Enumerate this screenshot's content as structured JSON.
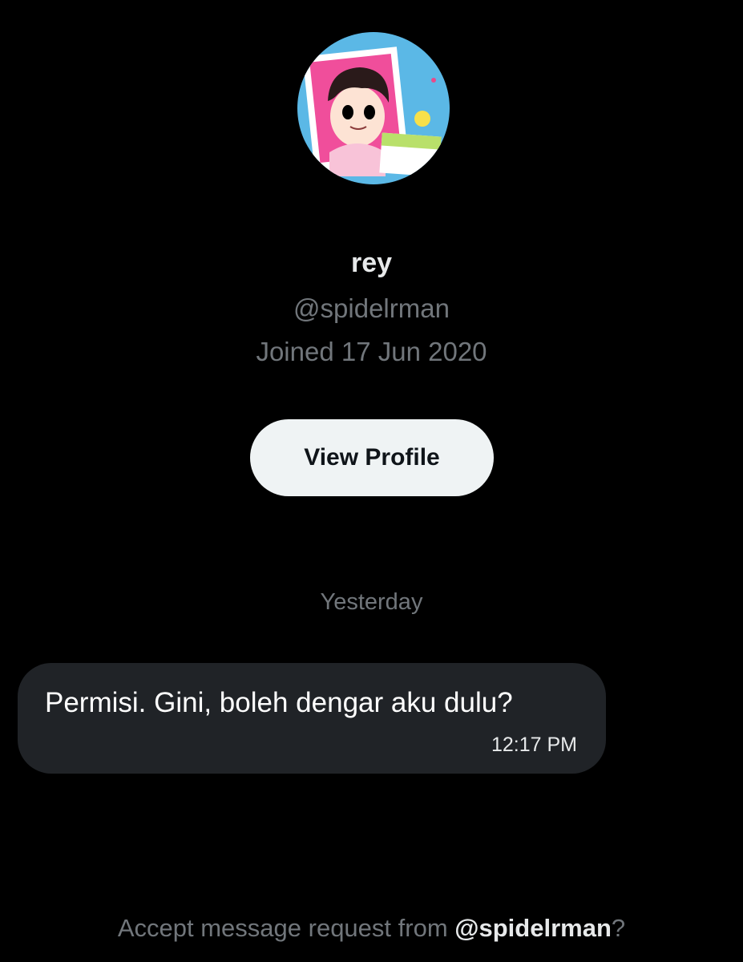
{
  "profile": {
    "avatar_icon": "profile-avatar-illustration",
    "display_name": "rey",
    "handle": "@spidelrman",
    "joined": "Joined 17 Jun 2020",
    "view_profile_label": "View Profile"
  },
  "conversation": {
    "day_separator": "Yesterday",
    "messages": [
      {
        "text": "Permisi. Gini, boleh dengar aku dulu?",
        "time": "12:17 PM"
      }
    ]
  },
  "request": {
    "prefix": "Accept message request from ",
    "handle": "@spidelrman",
    "suffix": "?"
  },
  "colors": {
    "background": "#000000",
    "primary_text": "#e7e9ea",
    "secondary_text": "#71767b",
    "bubble": "#202327",
    "button": "#eff3f4"
  }
}
